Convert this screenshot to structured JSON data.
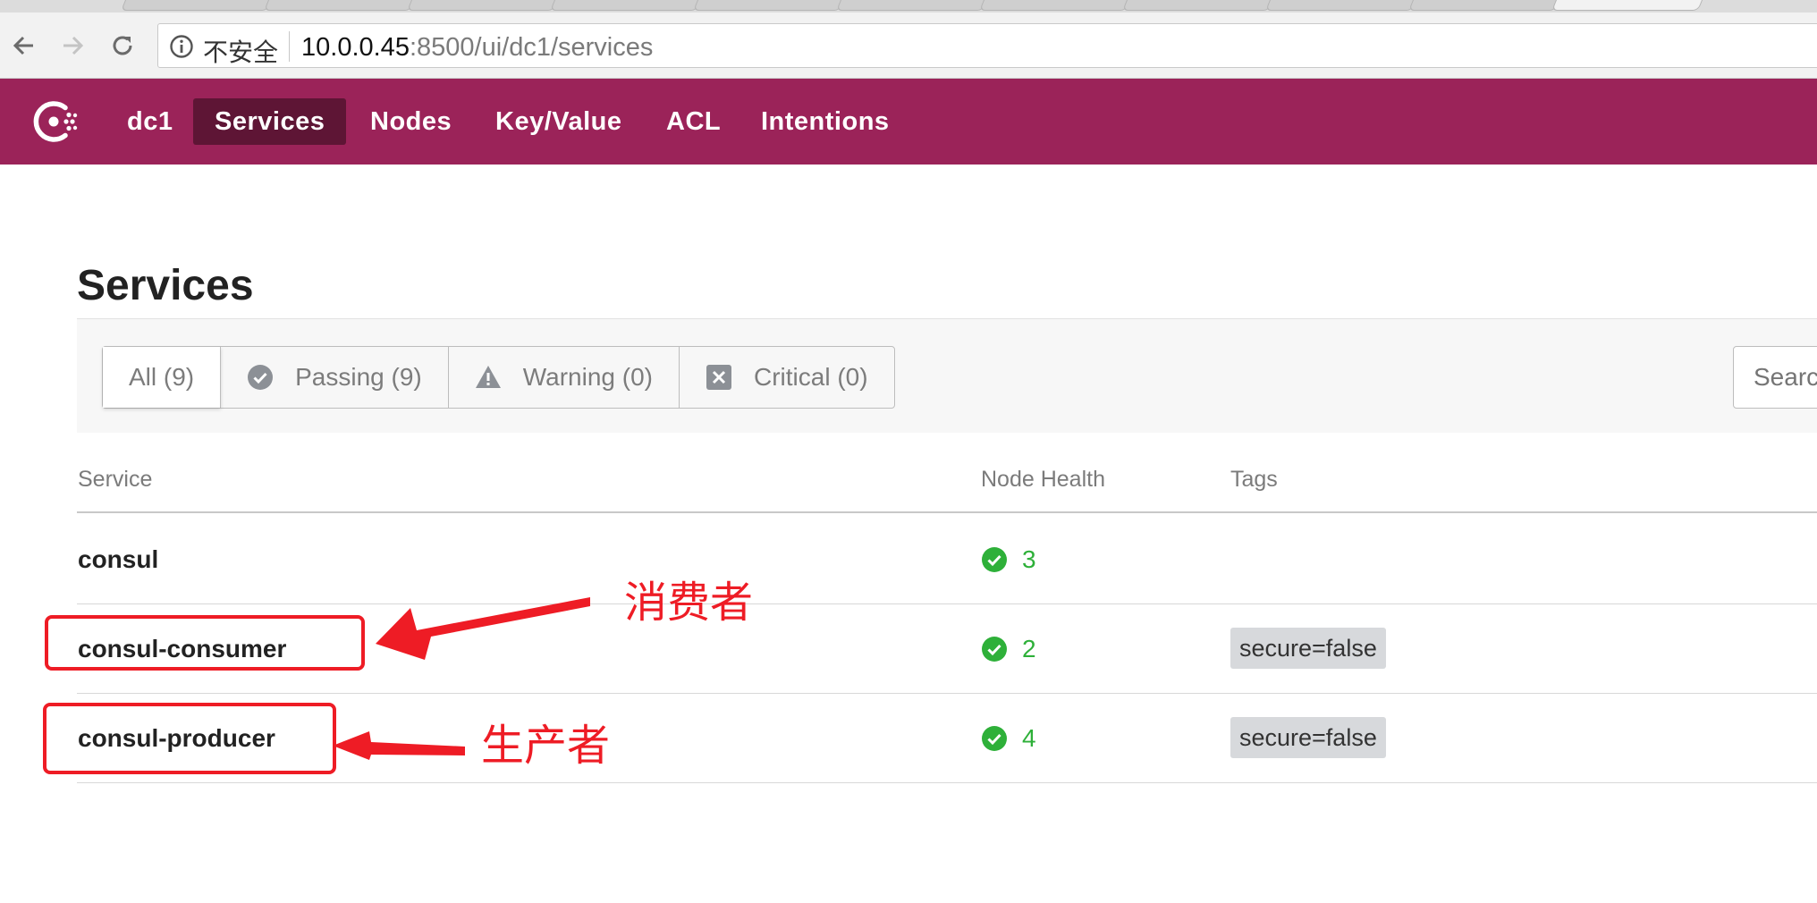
{
  "browser": {
    "security_label": "不安全",
    "url_host": "10.0.0.45",
    "url_path": ":8500/ui/dc1/services"
  },
  "nav": {
    "datacenter": "dc1",
    "items": [
      {
        "label": "Services",
        "active": true
      },
      {
        "label": "Nodes",
        "active": false
      },
      {
        "label": "Key/Value",
        "active": false
      },
      {
        "label": "ACL",
        "active": false
      },
      {
        "label": "Intentions",
        "active": false
      }
    ]
  },
  "page": {
    "title": "Services"
  },
  "filters": [
    {
      "label": "All (9)",
      "icon": "none",
      "active": true
    },
    {
      "label": "Passing (9)",
      "icon": "check-circle-icon",
      "active": false
    },
    {
      "label": "Warning (0)",
      "icon": "warning-triangle-icon",
      "active": false
    },
    {
      "label": "Critical (0)",
      "icon": "critical-x-icon",
      "active": false
    }
  ],
  "search": {
    "placeholder": "Search"
  },
  "table": {
    "columns": [
      "Service",
      "Node Health",
      "Tags"
    ],
    "rows": [
      {
        "service": "consul",
        "health": "3",
        "tags": ""
      },
      {
        "service": "consul-consumer",
        "health": "2",
        "tags": "secure=false"
      },
      {
        "service": "consul-producer",
        "health": "4",
        "tags": "secure=false"
      }
    ]
  },
  "annotations": {
    "consumer_label": "消费者",
    "producer_label": "生产者"
  },
  "colors": {
    "brand": "#9b2359",
    "brand_active": "#5e1535",
    "passing": "#2eb039",
    "annotation": "#ee1c25"
  }
}
